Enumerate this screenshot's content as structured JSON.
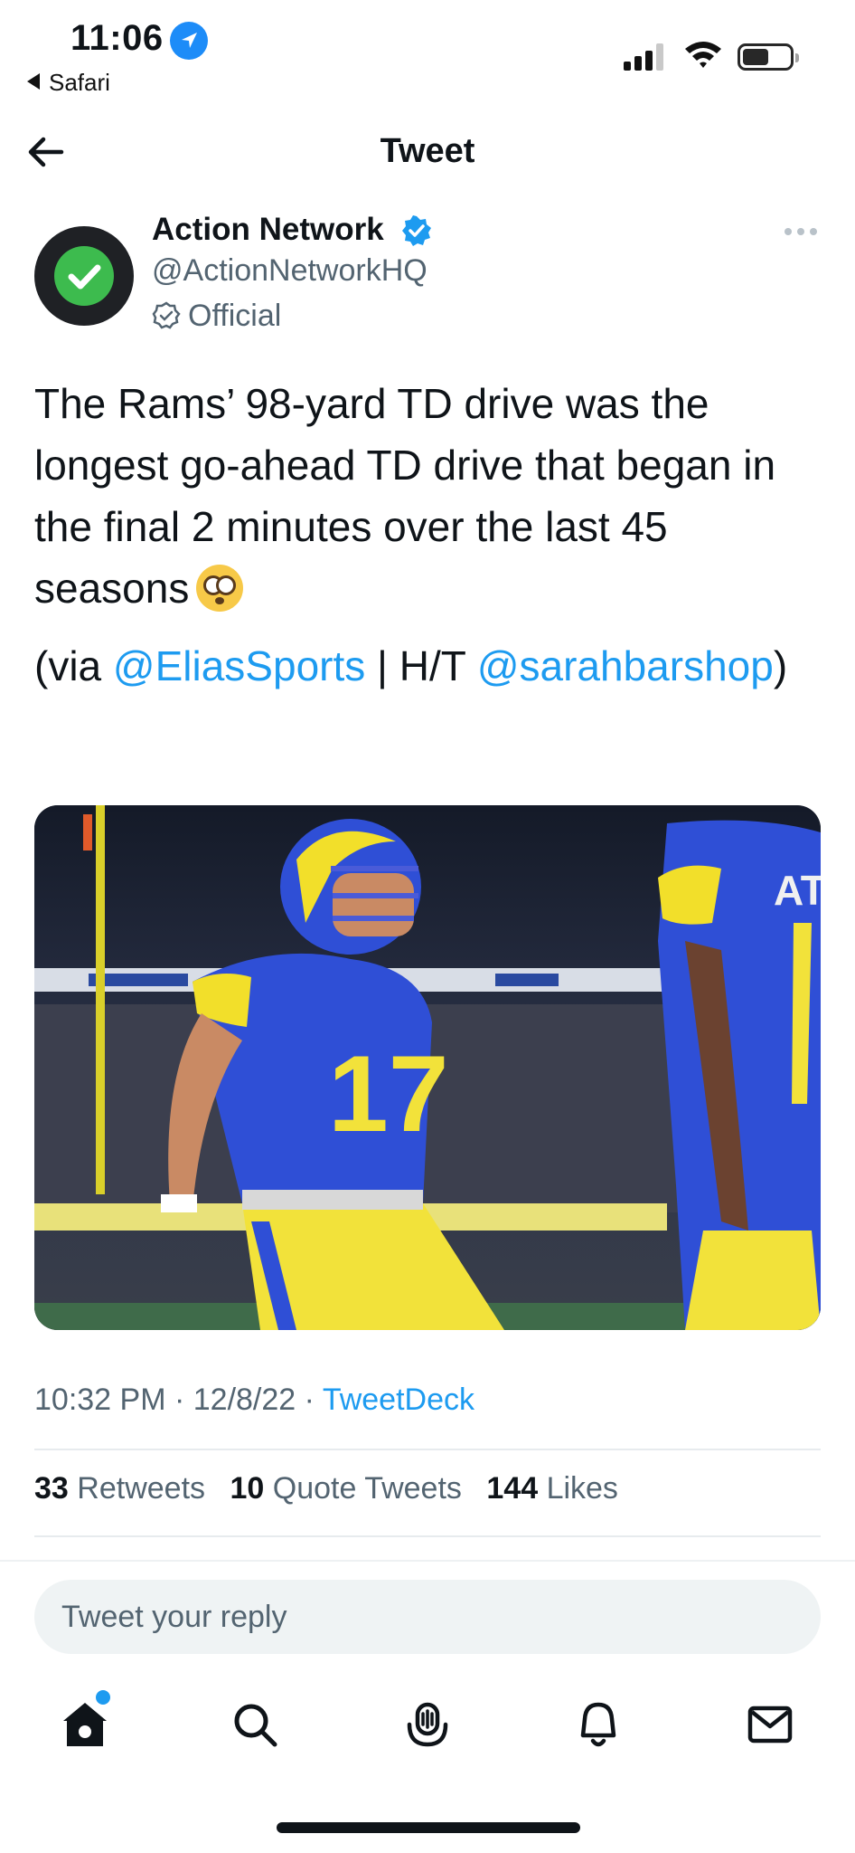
{
  "status_bar": {
    "time": "11:06",
    "back_app": "Safari",
    "icons": [
      "location-arrow-icon",
      "cellular-signal-icon",
      "wifi-icon",
      "battery-icon"
    ]
  },
  "header": {
    "title": "Tweet",
    "back_icon": "back-arrow-icon"
  },
  "author": {
    "name": "Action Network",
    "handle": "@ActionNetworkHQ",
    "label": "Official",
    "verified_icon": "verified-badge-icon",
    "more_icon": "more-options-icon"
  },
  "tweet": {
    "text": "The Rams’ 98-yard TD drive was the longest go-ahead TD drive that began in the final 2 minutes over the last 45 seasons",
    "emoji": "flushed-face-icon",
    "via_prefix": "(via ",
    "mention_1": "@EliasSports",
    "ht_text": " | H/T ",
    "mention_2": "@sarahbarshop",
    "via_suffix": ")",
    "media_alt": "Rams player number 17 celebrating on field"
  },
  "meta": {
    "time": "10:32 PM",
    "date": "12/8/22",
    "separator": " · ",
    "source": "TweetDeck"
  },
  "stats": {
    "retweets_count": "33",
    "retweets_label": "Retweets",
    "quotes_count": "10",
    "quotes_label": "Quote Tweets",
    "likes_count": "144",
    "likes_label": "Likes"
  },
  "reply": {
    "placeholder": "Tweet your reply"
  },
  "tab_bar": [
    "home-icon",
    "search-icon",
    "spaces-icon",
    "notifications-icon",
    "messages-icon"
  ],
  "colors": {
    "accent": "#1d9bf0",
    "text": "#0f1419",
    "secondary": "#536471",
    "avatar_bg": "#1f2125",
    "avatar_check": "#3dbb4e"
  }
}
